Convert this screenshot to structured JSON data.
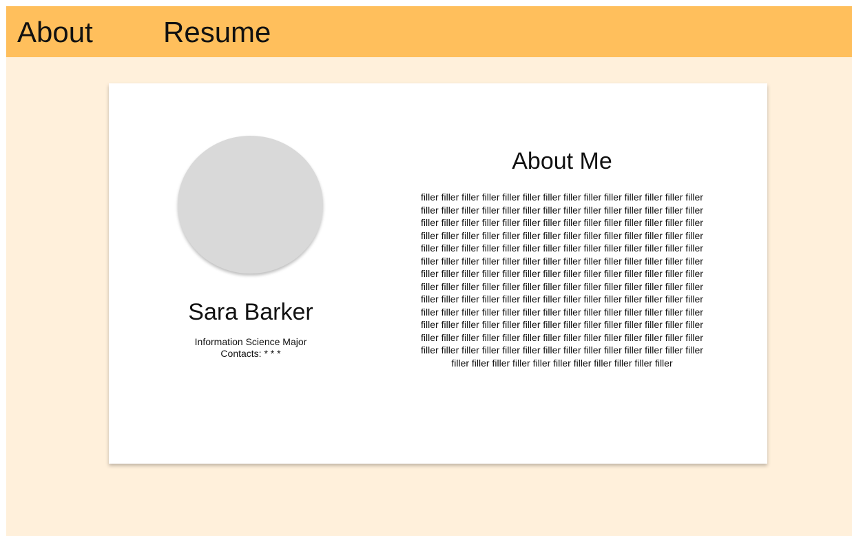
{
  "nav": {
    "about_label": "About",
    "resume_label": "Resume"
  },
  "profile": {
    "name": "Sara Barker",
    "major": "Information Science Major",
    "contacts": "Contacts: * * *"
  },
  "about": {
    "title": "About Me",
    "body": "filler filler filler filler filler filler filler filler filler filler filler filler filler filler filler filler filler filler filler filler filler filler filler filler filler filler filler filler filler filler filler filler filler filler filler filler filler filler filler filler filler filler filler filler filler filler filler filler filler filler filler filler filler filler filler filler filler filler filler filler filler filler filler filler filler filler filler filler filler filler filler filler filler filler filler filler filler filler filler filler filler filler filler filler filler filler filler filler filler filler filler filler filler filler filler filler filler filler filler filler filler filler filler filler filler filler filler filler filler filler filler filler filler filler filler filler filler filler filler filler filler filler filler filler filler filler filler filler filler filler filler filler filler filler filler filler filler filler filler filler filler filler filler filler filler filler filler filler filler filler filler filler filler filler filler filler filler filler filler filler filler filler filler filler filler filler filler filler filler filler filler filler filler filler filler filler filler filler filler filler filler filler filler filler filler filler filler filler filler filler filler filler filler"
  },
  "colors": {
    "navbar": "#ffbf5c",
    "page_background": "#fff0db",
    "card_background": "#ffffff",
    "avatar_placeholder": "#d9d9d9"
  }
}
